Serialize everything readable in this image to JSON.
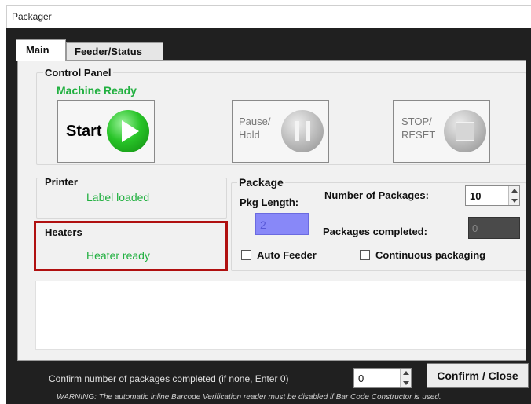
{
  "window": {
    "title": "Packager"
  },
  "tabs": [
    {
      "label": "Main",
      "active": true
    },
    {
      "label": "Feeder/Status",
      "active": false
    }
  ],
  "control_panel": {
    "label": "Control Panel",
    "status": "Machine Ready",
    "start_label": "Start",
    "pause_label_line1": "Pause/",
    "pause_label_line2": "Hold",
    "stop_label_line1": "STOP/",
    "stop_label_line2": "RESET"
  },
  "printer": {
    "label": "Printer",
    "status": "Label loaded"
  },
  "heaters": {
    "label": "Heaters",
    "status": "Heater ready"
  },
  "package": {
    "label": "Package",
    "pkg_length_label": "Pkg Length:",
    "pkg_length_value": "2",
    "num_packages_label": "Number of Packages:",
    "num_packages_value": "10",
    "packages_completed_label": "Packages completed:",
    "packages_completed_value": "0",
    "auto_feeder_label": "Auto Feeder",
    "continuous_label": "Continuous packaging"
  },
  "footer": {
    "confirm_prompt": "Confirm number of packages completed (if none, Enter 0)",
    "confirm_value": "0",
    "confirm_button": "Confirm / Close",
    "warning": "WARNING:  The automatic inline Barcode Verification reader must be disabled if Bar Code Constructor is used."
  },
  "colors": {
    "status_green": "#21b040",
    "highlight_red": "#b01010",
    "pkg_length_fill": "#8888f8",
    "frame_dark": "#202020"
  }
}
